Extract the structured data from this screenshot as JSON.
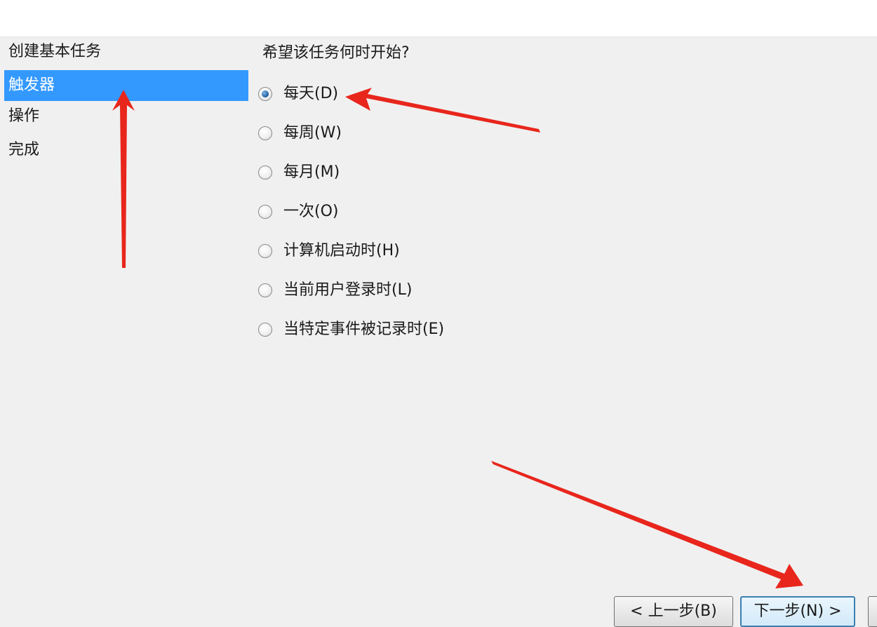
{
  "sidebar": {
    "items": [
      {
        "label": "创建基本任务",
        "selected": false
      },
      {
        "label": "触发器",
        "selected": true
      },
      {
        "label": "操作",
        "selected": false
      },
      {
        "label": "完成",
        "selected": false
      }
    ]
  },
  "main": {
    "question": "希望该任务何时开始?",
    "options": [
      {
        "label": "每天(D)",
        "checked": true
      },
      {
        "label": "每周(W)",
        "checked": false
      },
      {
        "label": "每月(M)",
        "checked": false
      },
      {
        "label": "一次(O)",
        "checked": false
      },
      {
        "label": "计算机启动时(H)",
        "checked": false
      },
      {
        "label": "当前用户登录时(L)",
        "checked": false
      },
      {
        "label": "当特定事件被记录时(E)",
        "checked": false
      }
    ]
  },
  "footer": {
    "back_label": "< 上一步(B)",
    "next_label": "下一步(N) >"
  },
  "colors": {
    "selection": "#3399ff",
    "annotation_arrow": "#e8261c"
  }
}
